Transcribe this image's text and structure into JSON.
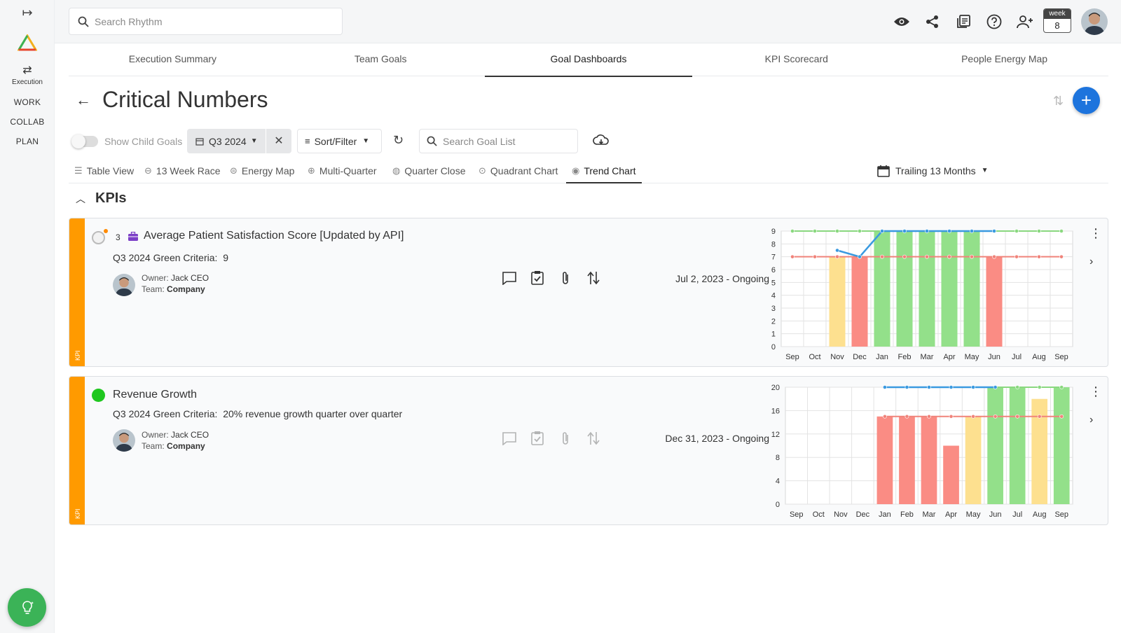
{
  "rail": {
    "execution_label": "Execution",
    "links": [
      "WORK",
      "COLLAB",
      "PLAN"
    ]
  },
  "search": {
    "placeholder": "Search Rhythm"
  },
  "week": {
    "label": "week",
    "number": "8"
  },
  "tabs": [
    {
      "label": "Execution Summary"
    },
    {
      "label": "Team Goals"
    },
    {
      "label": "Goal Dashboards",
      "active": true
    },
    {
      "label": "KPI Scorecard"
    },
    {
      "label": "People Energy Map"
    }
  ],
  "page": {
    "title": "Critical Numbers"
  },
  "toolbar": {
    "show_child_goals": "Show Child Goals",
    "quarter": "Q3 2024",
    "sort_filter": "Sort/Filter",
    "goal_search_placeholder": "Search Goal List"
  },
  "views": {
    "items": [
      {
        "label": "Table View"
      },
      {
        "label": "13 Week Race"
      },
      {
        "label": "Energy Map"
      },
      {
        "label": "Multi-Quarter"
      },
      {
        "label": "Quarter Close"
      },
      {
        "label": "Quadrant Chart"
      },
      {
        "label": "Trend Chart",
        "active": true
      }
    ],
    "trailing": "Trailing 13 Months"
  },
  "section": {
    "title": "KPIs"
  },
  "colors": {
    "accent": "#1d74dd",
    "kpi_stripe": "#ff9a00",
    "green_bar": "#93e08a",
    "red_bar": "#fa8c84",
    "yellow_bar": "#fde08f",
    "target_line": "#3a9ae0",
    "green_line": "#8ad87f",
    "red_line": "#f0837a",
    "status_green": "#1fc71f"
  },
  "kpis": [
    {
      "number": "3",
      "title": "Average Patient Satisfaction Score [Updated by API]",
      "criteria_label": "Q3 2024 Green Criteria:",
      "criteria_value": "9",
      "owner_label": "Owner:",
      "owner": "Jack CEO",
      "team_label": "Team:",
      "team": "Company",
      "date_range": "Jul 2, 2023 - Ongoing",
      "stripe_label": "KPI"
    },
    {
      "title": "Revenue Growth",
      "criteria_label": "Q3 2024 Green Criteria:",
      "criteria_value": "20% revenue growth quarter over quarter",
      "owner_label": "Owner:",
      "owner": "Jack CEO",
      "team_label": "Team:",
      "team": "Company",
      "date_range": "Dec 31, 2023 - Ongoing",
      "stripe_label": "KPI"
    }
  ],
  "chart_data": [
    {
      "type": "bar",
      "categories": [
        "Sep",
        "Oct",
        "Nov",
        "Dec",
        "Jan",
        "Feb",
        "Mar",
        "Apr",
        "May",
        "Jun",
        "Jul",
        "Aug",
        "Sep"
      ],
      "values": [
        null,
        null,
        7,
        7,
        9,
        9,
        9,
        9,
        9,
        7,
        null,
        null,
        null
      ],
      "bar_colors": [
        null,
        null,
        "yellow",
        "red",
        "green",
        "green",
        "green",
        "green",
        "green",
        "red",
        null,
        null,
        null
      ],
      "lines": [
        {
          "color": "green",
          "values": [
            9,
            9,
            9,
            9,
            9,
            9,
            9,
            9,
            9,
            9,
            9,
            9,
            9
          ]
        },
        {
          "color": "red",
          "values": [
            7,
            7,
            7,
            7,
            7,
            7,
            7,
            7,
            7,
            7,
            7,
            7,
            7
          ]
        },
        {
          "color": "blue",
          "values": [
            null,
            null,
            7.5,
            7,
            9,
            9,
            9,
            9,
            9,
            9,
            null,
            null,
            null
          ]
        }
      ],
      "yticks": [
        0,
        1,
        2,
        3,
        4,
        5,
        6,
        7,
        8,
        9
      ],
      "ylim": [
        0,
        9
      ],
      "grid": true
    },
    {
      "type": "bar",
      "categories": [
        "Sep",
        "Oct",
        "Nov",
        "Dec",
        "Jan",
        "Feb",
        "Mar",
        "Apr",
        "May",
        "Jun",
        "Jul",
        "Aug",
        "Sep"
      ],
      "values": [
        null,
        null,
        null,
        null,
        15,
        15,
        15,
        10,
        15,
        20,
        20,
        18,
        20
      ],
      "bar_colors": [
        null,
        null,
        null,
        null,
        "red",
        "red",
        "red",
        "red",
        "yellow",
        "green",
        "green",
        "yellow",
        "green"
      ],
      "lines": [
        {
          "color": "green",
          "values": [
            null,
            null,
            null,
            null,
            null,
            null,
            null,
            null,
            null,
            20,
            20,
            20,
            20
          ]
        },
        {
          "color": "red",
          "values": [
            null,
            null,
            null,
            null,
            15,
            15,
            15,
            15,
            15,
            15,
            15,
            15,
            15
          ]
        },
        {
          "color": "blue",
          "values": [
            null,
            null,
            null,
            null,
            20,
            20,
            20,
            20,
            20,
            20,
            null,
            null,
            null
          ]
        }
      ],
      "yticks": [
        0,
        4,
        8,
        12,
        16,
        20
      ],
      "ylim": [
        0,
        20
      ],
      "grid": true
    }
  ]
}
